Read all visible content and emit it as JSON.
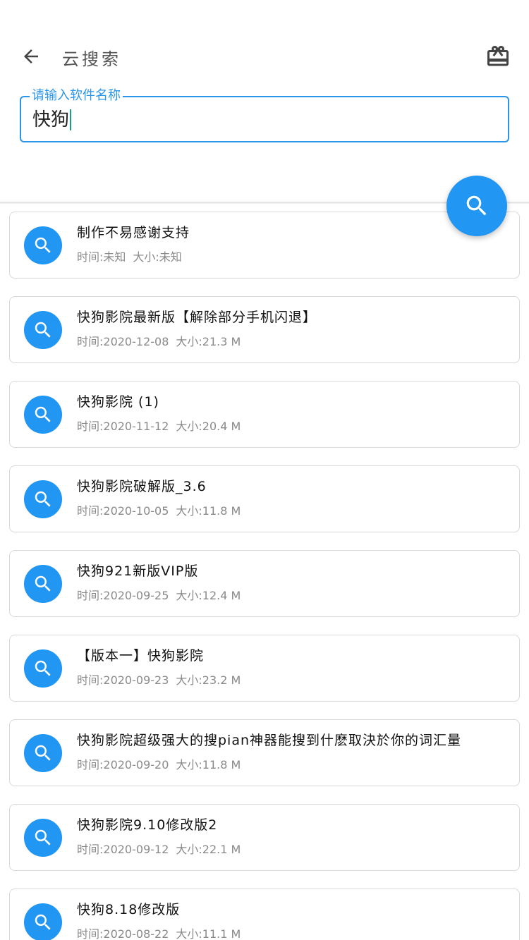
{
  "header": {
    "title": "云搜索",
    "back_icon": "arrow-back-icon",
    "gift_icon": "gift-box-icon"
  },
  "search": {
    "label": "请输入软件名称",
    "value": "快狗"
  },
  "fab": {
    "icon": "search-icon"
  },
  "colors": {
    "accent": "#2196f3",
    "field_border": "#2b95e9"
  },
  "results": [
    {
      "title": "制作不易感谢支持",
      "time": "时间:未知",
      "size": "大小:未知"
    },
    {
      "title": "快狗影院最新版【解除部分手机闪退】",
      "time": "时间:2020-12-08",
      "size": "大小:21.3 M"
    },
    {
      "title": "快狗影院 (1)",
      "time": "时间:2020-11-12",
      "size": "大小:20.4 M"
    },
    {
      "title": "快狗影院破解版_3.6",
      "time": "时间:2020-10-05",
      "size": "大小:11.8 M"
    },
    {
      "title": "快狗921新版VIP版",
      "time": "时间:2020-09-25",
      "size": "大小:12.4 M"
    },
    {
      "title": "【版本一】快狗影院",
      "time": "时间:2020-09-23",
      "size": "大小:23.2 M"
    },
    {
      "title": "快狗影院超级强大的搜pian神器能搜到什麽取決於你的词汇量",
      "time": "时间:2020-09-20",
      "size": "大小:11.8 M"
    },
    {
      "title": "快狗影院9.10修改版2",
      "time": "时间:2020-09-12",
      "size": "大小:22.1 M"
    },
    {
      "title": " 快狗8.18修改版",
      "time": "时间:2020-08-22",
      "size": "大小:11.1 M"
    }
  ]
}
